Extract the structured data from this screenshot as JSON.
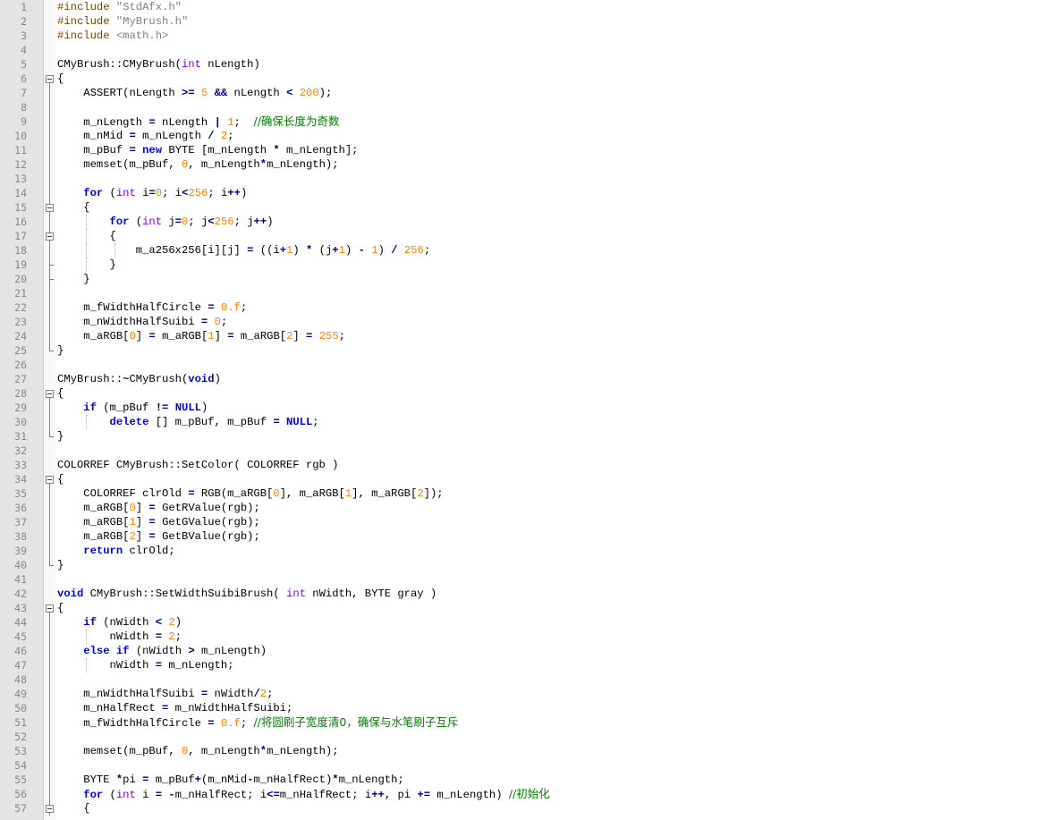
{
  "editor": {
    "lines": [
      {
        "n": "1",
        "fold": "",
        "text": "#include \"StdAfx.h\""
      },
      {
        "n": "2",
        "fold": "",
        "text": "#include \"MyBrush.h\""
      },
      {
        "n": "3",
        "fold": "",
        "text": "#include <math.h>"
      },
      {
        "n": "4",
        "fold": "",
        "text": ""
      },
      {
        "n": "5",
        "fold": "",
        "text": "CMyBrush::CMyBrush(int nLength)"
      },
      {
        "n": "6",
        "fold": "open",
        "text": "{"
      },
      {
        "n": "7",
        "fold": "line",
        "text": "    ASSERT(nLength >= 5 && nLength < 200);"
      },
      {
        "n": "8",
        "fold": "line",
        "text": ""
      },
      {
        "n": "9",
        "fold": "line",
        "text": "    m_nLength = nLength | 1;  //确保长度为奇数"
      },
      {
        "n": "10",
        "fold": "line",
        "text": "    m_nMid = m_nLength / 2;"
      },
      {
        "n": "11",
        "fold": "line",
        "text": "    m_pBuf = new BYTE [m_nLength * m_nLength];"
      },
      {
        "n": "12",
        "fold": "line",
        "text": "    memset(m_pBuf, 0, m_nLength*m_nLength);"
      },
      {
        "n": "13",
        "fold": "line",
        "text": ""
      },
      {
        "n": "14",
        "fold": "line",
        "text": "    for (int i=0; i<256; i++)"
      },
      {
        "n": "15",
        "fold": "open-inner",
        "text": "    {"
      },
      {
        "n": "16",
        "fold": "line",
        "text": "        for (int j=0; j<256; j++)"
      },
      {
        "n": "17",
        "fold": "open-inner",
        "text": "        {"
      },
      {
        "n": "18",
        "fold": "line",
        "text": "            m_a256x256[i][j] = ((i+1) * (j+1) - 1) / 256;"
      },
      {
        "n": "19",
        "fold": "end-inner",
        "text": "        }"
      },
      {
        "n": "20",
        "fold": "end-inner",
        "text": "    }"
      },
      {
        "n": "21",
        "fold": "line",
        "text": ""
      },
      {
        "n": "22",
        "fold": "line",
        "text": "    m_fWidthHalfCircle = 0.f;"
      },
      {
        "n": "23",
        "fold": "line",
        "text": "    m_nWidthHalfSuibi = 0;"
      },
      {
        "n": "24",
        "fold": "line",
        "text": "    m_aRGB[0] = m_aRGB[1] = m_aRGB[2] = 255;"
      },
      {
        "n": "25",
        "fold": "end",
        "text": "}"
      },
      {
        "n": "26",
        "fold": "",
        "text": ""
      },
      {
        "n": "27",
        "fold": "",
        "text": "CMyBrush::~CMyBrush(void)"
      },
      {
        "n": "28",
        "fold": "open",
        "text": "{"
      },
      {
        "n": "29",
        "fold": "line",
        "text": "    if (m_pBuf != NULL)"
      },
      {
        "n": "30",
        "fold": "line",
        "text": "        delete [] m_pBuf, m_pBuf = NULL;"
      },
      {
        "n": "31",
        "fold": "end",
        "text": "}"
      },
      {
        "n": "32",
        "fold": "",
        "text": ""
      },
      {
        "n": "33",
        "fold": "",
        "text": "COLORREF CMyBrush::SetColor( COLORREF rgb )"
      },
      {
        "n": "34",
        "fold": "open",
        "text": "{"
      },
      {
        "n": "35",
        "fold": "line",
        "text": "    COLORREF clrOld = RGB(m_aRGB[0], m_aRGB[1], m_aRGB[2]);"
      },
      {
        "n": "36",
        "fold": "line",
        "text": "    m_aRGB[0] = GetRValue(rgb);"
      },
      {
        "n": "37",
        "fold": "line",
        "text": "    m_aRGB[1] = GetGValue(rgb);"
      },
      {
        "n": "38",
        "fold": "line",
        "text": "    m_aRGB[2] = GetBValue(rgb);"
      },
      {
        "n": "39",
        "fold": "line",
        "text": "    return clrOld;"
      },
      {
        "n": "40",
        "fold": "end",
        "text": "}"
      },
      {
        "n": "41",
        "fold": "",
        "text": ""
      },
      {
        "n": "42",
        "fold": "",
        "text": "void CMyBrush::SetWidthSuibiBrush( int nWidth, BYTE gray )"
      },
      {
        "n": "43",
        "fold": "open",
        "text": "{"
      },
      {
        "n": "44",
        "fold": "line",
        "text": "    if (nWidth < 2)"
      },
      {
        "n": "45",
        "fold": "line",
        "text": "        nWidth = 2;"
      },
      {
        "n": "46",
        "fold": "line",
        "text": "    else if (nWidth > m_nLength)"
      },
      {
        "n": "47",
        "fold": "line",
        "text": "        nWidth = m_nLength;"
      },
      {
        "n": "48",
        "fold": "line",
        "text": ""
      },
      {
        "n": "49",
        "fold": "line",
        "text": "    m_nWidthHalfSuibi = nWidth/2;"
      },
      {
        "n": "50",
        "fold": "line",
        "text": "    m_nHalfRect = m_nWidthHalfSuibi;"
      },
      {
        "n": "51",
        "fold": "line",
        "text": "    m_fWidthHalfCircle = 0.f; //将圆刷子宽度清0，确保与水笔刷子互斥"
      },
      {
        "n": "52",
        "fold": "line",
        "text": ""
      },
      {
        "n": "53",
        "fold": "line",
        "text": "    memset(m_pBuf, 0, m_nLength*m_nLength);"
      },
      {
        "n": "54",
        "fold": "line",
        "text": ""
      },
      {
        "n": "55",
        "fold": "line",
        "text": "    BYTE *pi = m_pBuf+(m_nMid-m_nHalfRect)*m_nLength;"
      },
      {
        "n": "56",
        "fold": "line",
        "text": "    for (int i = -m_nHalfRect; i<=m_nHalfRect; i++, pi += m_nLength) //初始化"
      },
      {
        "n": "57",
        "fold": "open-inner",
        "text": "    {"
      }
    ],
    "colors": {
      "keyword": "#0000ff",
      "type": "#8000ff",
      "number": "#ff8000",
      "operator": "#000080",
      "preprocessor": "#804000",
      "comment": "#008000",
      "line_number": "#888888",
      "gutter_bg": "#e4e4e4"
    }
  }
}
